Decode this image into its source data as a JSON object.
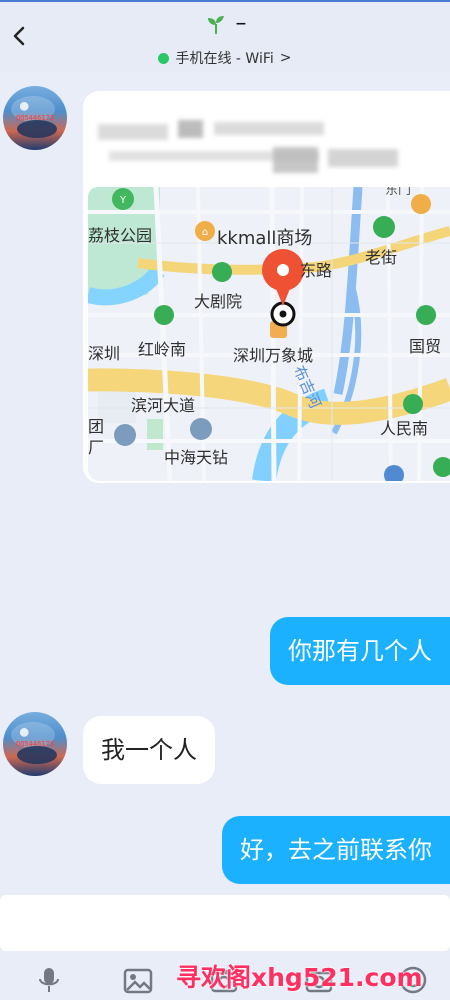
{
  "header": {
    "title_dash": "–",
    "status_text": "手机在线 - WiFi",
    "status_chevron": ">"
  },
  "avatar": {
    "label": "QQ5446173"
  },
  "map": {
    "labels": {
      "lizhi": "荔枝公园",
      "kkmall": "kkmall商场",
      "eastroad": "东路",
      "laojie": "老街",
      "daju": "大剧院",
      "hongling": "红岭南",
      "shenzhen": "深圳",
      "mixc": "深圳万象城",
      "guomao": "国贸",
      "binhe": "滨河大道",
      "tuan": "团",
      "factory": "厂",
      "zhonghai": "中海天钻",
      "renmin": "人民南",
      "river": "布吉河",
      "dongmen": "东门"
    }
  },
  "messages": {
    "m1": "你那有几个人",
    "m2": "我一个人",
    "m3": "好，去之前联系你"
  },
  "input": {
    "placeholder": ""
  },
  "footer": {
    "watermark": "寻欢阁xhg521.com"
  },
  "colors": {
    "accent": "#1cb1ff",
    "online": "#29c765",
    "pin": "#f04a2f"
  }
}
